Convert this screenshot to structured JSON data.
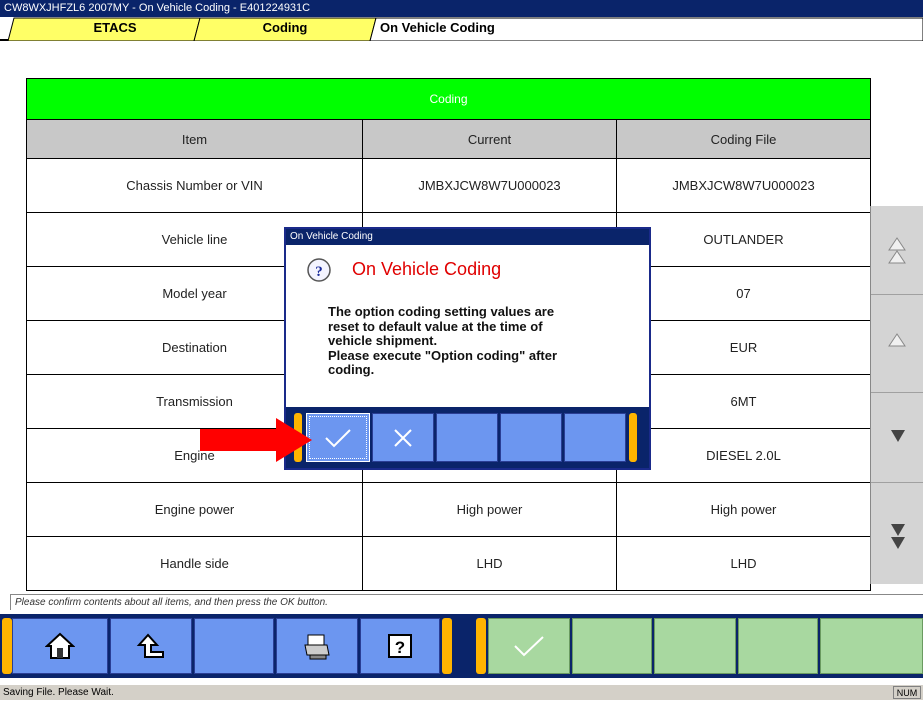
{
  "window": {
    "title": "CW8WXJHFZL6 2007MY   -  On Vehicle Coding  -  E401224931C"
  },
  "tabs": [
    {
      "label": "ETACS"
    },
    {
      "label": "Coding"
    },
    {
      "label": "On Vehicle Coding"
    }
  ],
  "table": {
    "section_header": "Coding",
    "columns": [
      "Item",
      "Current",
      "Coding File"
    ],
    "rows": [
      {
        "item": "Chassis Number or VIN",
        "current": "JMBXJCW8W7U000023",
        "file": "JMBXJCW8W7U000023"
      },
      {
        "item": "Vehicle line",
        "current": "",
        "file": "OUTLANDER"
      },
      {
        "item": "Model year",
        "current": "",
        "file": "07"
      },
      {
        "item": "Destination",
        "current": "",
        "file": "EUR"
      },
      {
        "item": "Transmission",
        "current": "",
        "file": "6MT"
      },
      {
        "item": "Engine",
        "current": "",
        "file": "DIESEL 2.0L"
      },
      {
        "item": "Engine power",
        "current": "High power",
        "file": "High power"
      },
      {
        "item": "Handle side",
        "current": "LHD",
        "file": "LHD"
      }
    ]
  },
  "message": "Please confirm contents about all items, and then press the OK button.",
  "status": {
    "text": "Saving File.  Please Wait.",
    "indicator": "NUM"
  },
  "dialog": {
    "window_title": "On Vehicle Coding",
    "heading": "On Vehicle Coding",
    "body_lines": [
      "The option coding setting values are",
      "reset to default value at the time of",
      "vehicle shipment.",
      "Please execute \"Option coding\" after",
      "coding."
    ],
    "icon": "question-icon"
  },
  "icons": {
    "home": "home-icon",
    "up": "up-arrow-icon",
    "printer": "printer-icon",
    "help": "help-icon",
    "ok": "checkmark-icon",
    "cancel": "x-mark-icon"
  },
  "colors": {
    "accent_green": "#00ff00",
    "navy": "#0a246a",
    "button_blue": "#6c96f0",
    "tab_yellow": "#ffff66",
    "orange_cap": "#ffb400",
    "red_heading": "#e00000"
  }
}
